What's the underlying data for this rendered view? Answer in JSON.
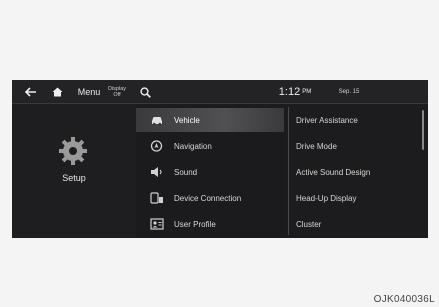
{
  "topbar": {
    "back_icon": "back-arrow-icon",
    "home_icon": "home-icon",
    "menu_label": "Menu",
    "display_off_line1": "Display",
    "display_off_line2": "Off",
    "search_icon": "search-icon",
    "time": "1:12",
    "ampm": "PM",
    "date": "Sep. 15"
  },
  "left": {
    "icon": "gear-icon",
    "label": "Setup"
  },
  "categories": [
    {
      "label": "Vehicle",
      "icon": "car-icon",
      "selected": true
    },
    {
      "label": "Navigation",
      "icon": "navigation-icon",
      "selected": false
    },
    {
      "label": "Sound",
      "icon": "speaker-icon",
      "selected": false
    },
    {
      "label": "Device Connection",
      "icon": "device-connection-icon",
      "selected": false
    },
    {
      "label": "User Profile",
      "icon": "user-profile-icon",
      "selected": false
    }
  ],
  "submenu": [
    {
      "label": "Driver Assistance"
    },
    {
      "label": "Drive Mode"
    },
    {
      "label": "Active Sound Design"
    },
    {
      "label": "Head-Up Display"
    },
    {
      "label": "Cluster"
    }
  ],
  "image_code": "OJK040036L",
  "colors": {
    "screen_bg": "#1c1c1e",
    "selected_bg": "#505052",
    "text": "#d8d8d8"
  }
}
